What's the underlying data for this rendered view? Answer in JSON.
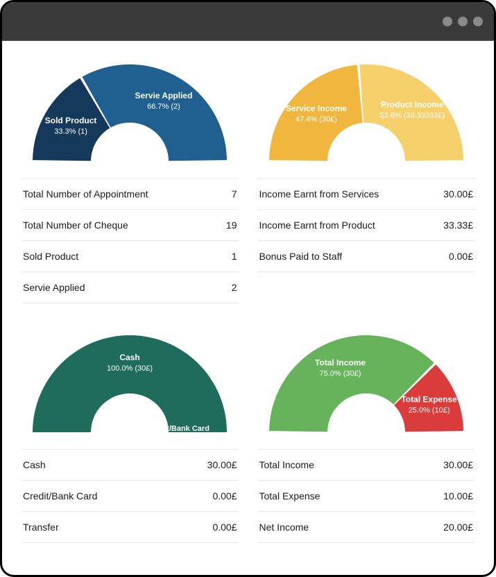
{
  "panels": [
    {
      "id": "appointments",
      "rows": [
        {
          "label": "Total Number of Appointment",
          "value": "7"
        },
        {
          "label": "Total Number of Cheque",
          "value": "19"
        },
        {
          "label": "Sold Product",
          "value": "1"
        },
        {
          "label": "Servie Applied",
          "value": "2"
        }
      ],
      "chart": {
        "slices": [
          {
            "name": "Sold Product",
            "sub": "33.3% (1)",
            "fraction": 0.333,
            "color": "#14395a"
          },
          {
            "name": "Servie Applied",
            "sub": "66.7% (2)",
            "fraction": 0.667,
            "color": "#1f6091"
          }
        ]
      }
    },
    {
      "id": "income-sources",
      "rows": [
        {
          "label": "Income Earnt from Services",
          "value": "30.00£"
        },
        {
          "label": "Income Earnt from Product",
          "value": "33.33£"
        },
        {
          "label": "Bonus Paid to Staff",
          "value": "0.00£"
        }
      ],
      "chart": {
        "slices": [
          {
            "name": "Service Income",
            "sub": "47.4% (30£)",
            "fraction": 0.474,
            "color": "#f1b63e"
          },
          {
            "name": "Product Income",
            "sub": "52.6% (33.33333£)",
            "fraction": 0.526,
            "color": "#f6d06a"
          }
        ]
      }
    },
    {
      "id": "payment-methods",
      "rows": [
        {
          "label": "Cash",
          "value": "30.00£"
        },
        {
          "label": "Credit/Bank Card",
          "value": "0.00£"
        },
        {
          "label": "Transfer",
          "value": "0.00£"
        }
      ],
      "chart": {
        "slices": [
          {
            "name": "Cash",
            "sub": "100.0% (30£)",
            "fraction": 1.0,
            "color": "#1f6b5c"
          }
        ],
        "overlay": "Credit/Bank Card"
      }
    },
    {
      "id": "net",
      "rows": [
        {
          "label": "Total Income",
          "value": "30.00£"
        },
        {
          "label": "Total Expense",
          "value": "10.00£"
        },
        {
          "label": "Net Income",
          "value": "20.00£"
        }
      ],
      "chart": {
        "slices": [
          {
            "name": "Total Income",
            "sub": "75.0% (30£)",
            "fraction": 0.75,
            "color": "#67b35b"
          },
          {
            "name": "Total Expense",
            "sub": "25.0% (10£)",
            "fraction": 0.25,
            "color": "#da3b3b"
          }
        ]
      }
    }
  ],
  "chart_data": [
    {
      "type": "pie",
      "title": "",
      "categories": [
        "Sold Product",
        "Servie Applied"
      ],
      "values": [
        1,
        2
      ]
    },
    {
      "type": "pie",
      "title": "",
      "categories": [
        "Service Income",
        "Product Income"
      ],
      "values": [
        30,
        33.33
      ]
    },
    {
      "type": "pie",
      "title": "",
      "categories": [
        "Cash",
        "Credit/Bank Card",
        "Transfer"
      ],
      "values": [
        30,
        0,
        0
      ]
    },
    {
      "type": "pie",
      "title": "",
      "categories": [
        "Total Income",
        "Total Expense"
      ],
      "values": [
        30,
        10
      ]
    }
  ]
}
